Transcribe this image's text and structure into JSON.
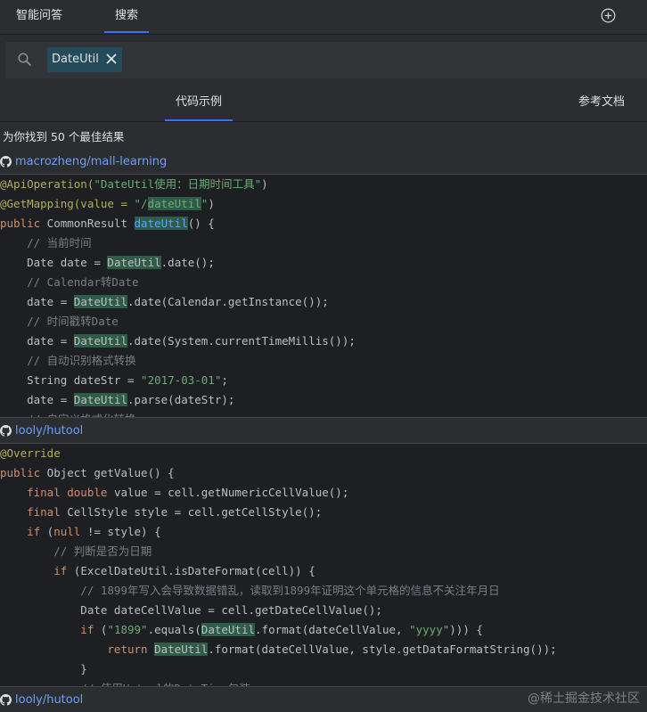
{
  "tabs": {
    "qa": "智能问答",
    "search": "搜索"
  },
  "search": {
    "chip_label": "DateUtil"
  },
  "subtabs": {
    "code_examples": "代码示例",
    "reference_docs": "参考文档"
  },
  "result_count": "为你找到 50 个最佳结果",
  "results": [
    {
      "repo": "macrozheng/mall-learning"
    },
    {
      "repo": "looly/hutool"
    },
    {
      "repo": "looly/hutool"
    }
  ],
  "code1": {
    "l1a": "@ApiOperation(",
    "l1b": "\"DateUtil使用：日期时间工具\"",
    "l1c": ")",
    "l2a": "@GetMapping(value = ",
    "l2b": "\"/",
    "l2c": "dateUtil",
    "l2d": "\"",
    "l2e": ")",
    "l3a": "public",
    "l3b": " CommonResult ",
    "l3c": "dateUtil",
    "l3d": "() {",
    "l4": "    // 当前时间",
    "l5a": "    Date date = ",
    "l5b": "DateUtil",
    "l5c": ".date();",
    "l6": "    // Calendar转Date",
    "l7a": "    date = ",
    "l7b": "DateUtil",
    "l7c": ".date(Calendar.getInstance());",
    "l8": "    // 时间戳转Date",
    "l9a": "    date = ",
    "l9b": "DateUtil",
    "l9c": ".date(System.currentTimeMillis());",
    "l10": "    // 自动识别格式转换",
    "l11a": "    String dateStr = ",
    "l11b": "\"2017-03-01\"",
    "l11c": ";",
    "l12a": "    date = ",
    "l12b": "DateUtil",
    "l12c": ".parse(dateStr);",
    "l13": "    // 自定义格式化转换"
  },
  "code2": {
    "l1": "@Override",
    "l2a": "public",
    "l2b": " Object getValue() {",
    "l3a": "    final double",
    "l3b": " value = cell.getNumericCellValue();",
    "l4a": "    final",
    "l4b": " CellStyle style = cell.getCellStyle();",
    "l5a": "    if",
    "l5b": " (",
    "l5c": "null",
    "l5d": " != style) {",
    "l6": "        // 判断是否为日期",
    "l7a": "        if",
    "l7b": " (ExcelDateUtil.isDateFormat(cell)) {",
    "l8": "            // 1899年写入会导致数据错乱，读取到1899年证明这个单元格的信息不关注年月日",
    "l9": "            Date dateCellValue = cell.getDateCellValue();",
    "l10a": "            if",
    "l10b": " (",
    "l10c": "\"1899\"",
    "l10d": ".equals(",
    "l10e": "DateUtil",
    "l10f": ".format(dateCellValue, ",
    "l10g": "\"yyyy\"",
    "l10h": "))) {",
    "l11a": "                return",
    "l11b": " ",
    "l11c": "DateUtil",
    "l11d": ".format(dateCellValue, style.getDataFormatString());",
    "l12": "            }",
    "l13": "            // 使用Hutool的DateTime包装"
  },
  "watermark": "@稀土掘金技术社区"
}
